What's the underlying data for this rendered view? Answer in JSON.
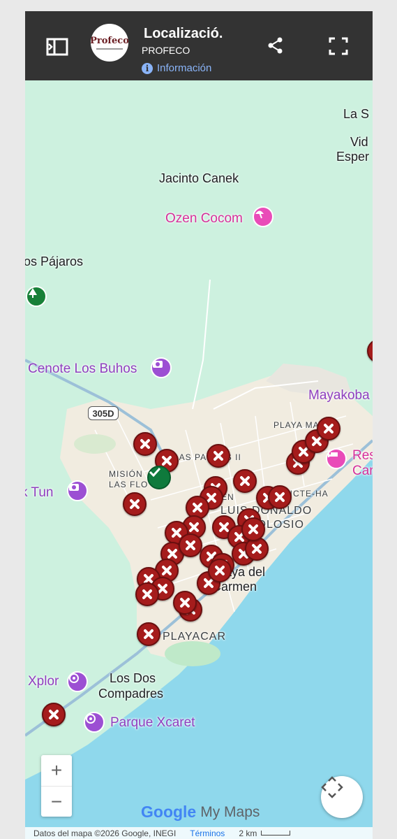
{
  "header": {
    "title": "Localizació.",
    "subtitle": "PROFECO",
    "info_label": "Información",
    "logo_text": "Profeco",
    "background": "#333333"
  },
  "map": {
    "places": {
      "la_s": "La S",
      "vid": "Vid",
      "esper": "Esper",
      "jacinto_canek": "Jacinto Canek",
      "ozen_cocom": "Ozen Cocom",
      "los_pajaros": "os Pájaros",
      "cenote_los_buhos": "Cenote Los Buhos",
      "route_305d": "305D",
      "mayakoba": "Mayakoba",
      "playa_magna": "PLAYA MAGNA",
      "res": "Res",
      "car": "Car",
      "mision_las_flores_1": "MISIÓN",
      "mision_las_flores_2": "LAS FLO",
      "las_palmas": "LAS PALMAS II",
      "k_tun": "k Tun",
      "men": "MEN",
      "nicte_ha": "NICTE-HA",
      "luis_donaldo_1": "LUIS DONALDO",
      "luis_donaldo_2": "COLOSIO",
      "playa_del_carmen_1": "Playa del",
      "playa_del_carmen_2": "Carmen",
      "playacar": "PLAYACAR",
      "xplor": "Xplor",
      "los_dos_compadres_1": "Los Dos",
      "los_dos_compadres_2": "Compadres",
      "parque_xcaret": "Parque Xcaret"
    },
    "markers": {
      "closed_count": 48,
      "open_count": 1,
      "closed_color": "#a51c1c",
      "open_color": "#0f7a3c"
    },
    "zoom_in": "+",
    "zoom_out": "−",
    "brand_google": "Google",
    "brand_mymaps": "My Maps",
    "footer": {
      "attribution": "Datos del mapa ©2026 Google, INEGI",
      "terms": "Términos",
      "scale": "2 km"
    },
    "colors": {
      "land": "#cdf1df",
      "water": "#8fd8ec",
      "urban": "#f1ece0",
      "road": "#ffffff"
    }
  }
}
